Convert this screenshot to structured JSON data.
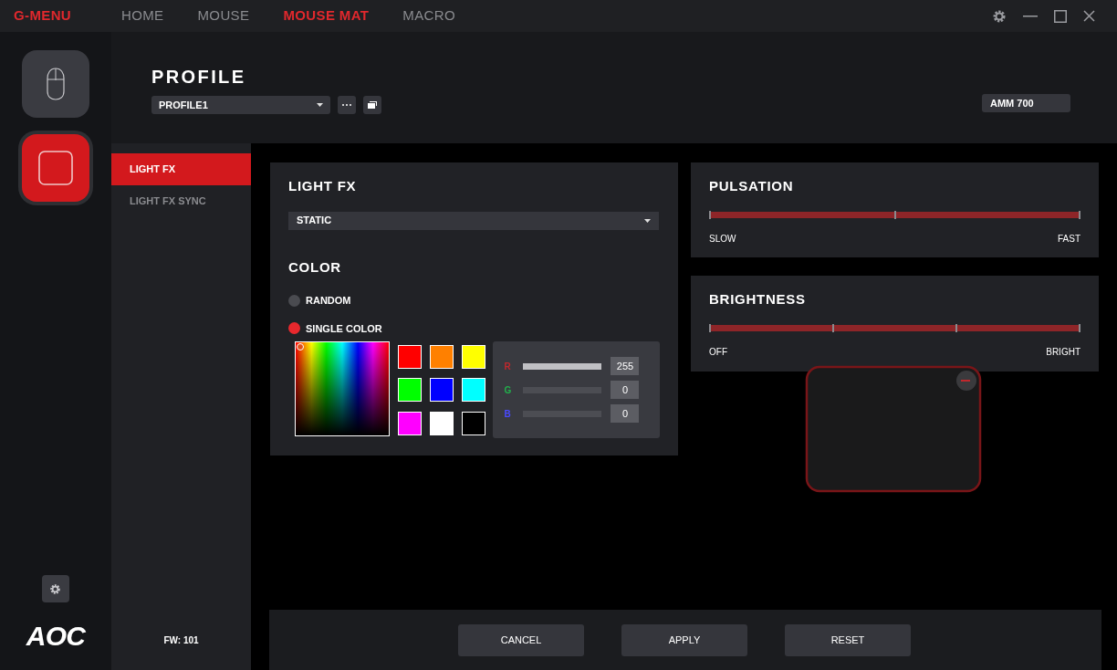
{
  "app": {
    "logo": "G-MENU",
    "brand": "AOC",
    "firmware": "FW: 101"
  },
  "tabs": [
    {
      "label": "HOME",
      "selected": false
    },
    {
      "label": "MOUSE",
      "selected": false
    },
    {
      "label": "MOUSE MAT",
      "selected": true
    },
    {
      "label": "MACRO",
      "selected": false
    }
  ],
  "devices": [
    {
      "kind": "mouse",
      "selected": false
    },
    {
      "kind": "mousemat",
      "selected": true
    }
  ],
  "profile": {
    "title": "PROFILE",
    "value": "PROFILE1",
    "device": "AMM 700"
  },
  "subnav": [
    {
      "label": "LIGHT FX",
      "selected": true
    },
    {
      "label": "LIGHT FX SYNC",
      "selected": false
    }
  ],
  "light_fx": {
    "title": "LIGHT FX",
    "effect": "STATIC",
    "color_title": "COLOR",
    "modes": [
      {
        "label": "RANDOM",
        "selected": false
      },
      {
        "label": "SINGLE COLOR",
        "selected": true
      }
    ],
    "swatches": [
      {
        "color": "#ff0000"
      },
      {
        "color": "#ff8000"
      },
      {
        "color": "#ffff00"
      },
      {
        "color": "#00ff00"
      },
      {
        "color": "#0000ff"
      },
      {
        "color": "#00ffff"
      },
      {
        "color": "#ff00ff"
      },
      {
        "color": "#ffffff"
      },
      {
        "color": "#000000"
      }
    ],
    "channels": [
      {
        "label": "R",
        "color": "#c0282d",
        "level": 1,
        "value": "255"
      },
      {
        "label": "G",
        "color": "#22b14c",
        "level": 0,
        "value": "0"
      },
      {
        "label": "B",
        "color": "#4a4aff",
        "level": 0,
        "value": "0"
      }
    ]
  },
  "sliders": [
    {
      "title": "PULSATION",
      "min_label": "SLOW",
      "max_label": "FAST"
    },
    {
      "title": "BRIGHTNESS",
      "min_label": "OFF",
      "max_label": "BRIGHT"
    }
  ],
  "buttons": [
    "CANCEL",
    "APPLY",
    "RESET"
  ]
}
